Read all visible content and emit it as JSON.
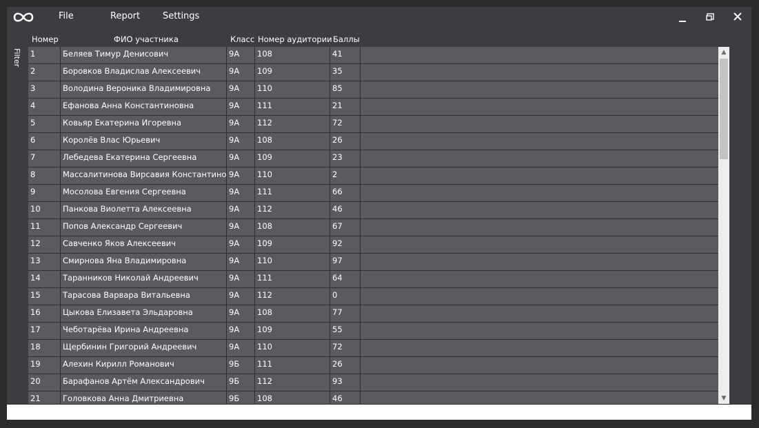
{
  "menu": {
    "logo_icon": "infinity-icon",
    "file": "File",
    "report": "Report",
    "settings": "Settings"
  },
  "window_controls": [
    "minimize-icon",
    "restore-icon",
    "close-icon"
  ],
  "sidebar": {
    "filter": "Filter"
  },
  "table": {
    "columns": [
      "Номер",
      "ФИО участника",
      "Класс",
      "Номер аудитории",
      "Баллы"
    ],
    "rows": [
      [
        "1",
        "Беляев Тимур Денисович",
        "9А",
        "108",
        "41"
      ],
      [
        "2",
        "Боровков Владислав Алексеевич",
        "9А",
        "109",
        "35"
      ],
      [
        "3",
        "Володина Вероника Владимировна",
        "9А",
        "110",
        "85"
      ],
      [
        "4",
        "Ефанова Анна Константиновна",
        "9А",
        "111",
        "21"
      ],
      [
        "5",
        "Ковьяр Екатерина Игоревна",
        "9А",
        "112",
        "72"
      ],
      [
        "6",
        "Королёв Влас Юрьевич",
        "9А",
        "108",
        "26"
      ],
      [
        "7",
        "Лебедева Екатерина Сергеевна",
        "9А",
        "109",
        "23"
      ],
      [
        "8",
        "Массалитинова Вирсавия Константиновна",
        "9А",
        "110",
        "2"
      ],
      [
        "9",
        "Мосолова Евгения Сергеевна",
        "9А",
        "111",
        "66"
      ],
      [
        "10",
        "Панкова Виолетта Алексеевна",
        "9А",
        "112",
        "46"
      ],
      [
        "11",
        "Попов Александр Сергеевич",
        "9А",
        "108",
        "67"
      ],
      [
        "12",
        "Савченко Яков Алексеевич",
        "9А",
        "109",
        "92"
      ],
      [
        "13",
        "Смирнова Яна Владимировна",
        "9А",
        "110",
        "97"
      ],
      [
        "14",
        "Таранников Николай Андреевич",
        "9А",
        "111",
        "64"
      ],
      [
        "15",
        "Тарасова Варвара Витальевна",
        "9А",
        "112",
        "0"
      ],
      [
        "16",
        "Цыкова Елизавета Эльдаровна",
        "9А",
        "108",
        "77"
      ],
      [
        "17",
        "Чеботарёва Ирина Андреевна",
        "9А",
        "109",
        "55"
      ],
      [
        "18",
        "Щербинин Григорий Андреевич",
        "9А",
        "110",
        "72"
      ],
      [
        "19",
        "Алехин Кирилл Романович",
        "9Б",
        "111",
        "26"
      ],
      [
        "20",
        "Барафанов Артём Александрович",
        "9Б",
        "112",
        "93"
      ],
      [
        "21",
        "Головкова Анна Дмитриевна",
        "9Б",
        "108",
        "46"
      ]
    ]
  }
}
